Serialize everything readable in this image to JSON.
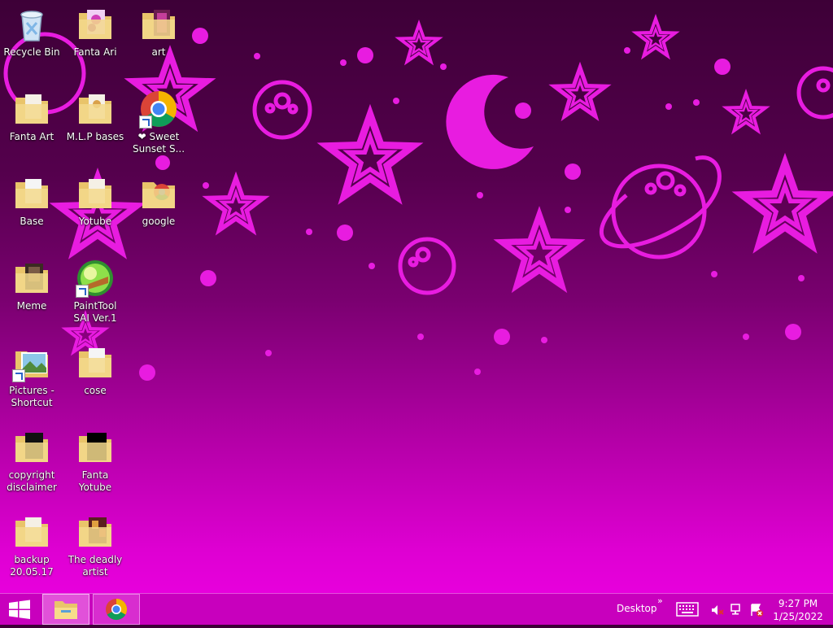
{
  "desktop": {
    "icons": [
      {
        "label": "Recycle Bin",
        "icon": "recycle-bin-icon"
      },
      {
        "label": "Fanta Ari",
        "icon": "folder-icon"
      },
      {
        "label": "art",
        "icon": "folder-icon"
      },
      {
        "label": "Fanta Art",
        "icon": "folder-icon"
      },
      {
        "label": "M.L.P bases",
        "icon": "folder-icon"
      },
      {
        "label": "❤ Sweet Sunset S...",
        "icon": "chrome-icon"
      },
      {
        "label": "Base",
        "icon": "folder-icon"
      },
      {
        "label": "Yotube",
        "icon": "folder-icon"
      },
      {
        "label": "google",
        "icon": "folder-icon"
      },
      {
        "label": "Meme",
        "icon": "folder-icon"
      },
      {
        "label": "PaintTool SAI Ver.1",
        "icon": "painttool-sai-icon"
      },
      {
        "label": "Pictures - Shortcut",
        "icon": "pictures-icon"
      },
      {
        "label": "cose",
        "icon": "folder-icon"
      },
      {
        "label": "copyright disclaimer",
        "icon": "folder-icon"
      },
      {
        "label": "Fanta Yotube",
        "icon": "folder-icon"
      },
      {
        "label": "backup 20.05.17",
        "icon": "folder-icon"
      },
      {
        "label": "The deadly artist",
        "icon": "folder-icon"
      }
    ]
  },
  "taskbar": {
    "start_icon": "windows-logo-icon",
    "pinned": [
      "file-explorer-icon",
      "chrome-icon"
    ],
    "desktop_toolbar_label": "Desktop",
    "overflow_chevron": "»",
    "tray_icons": [
      "touch-keyboard-icon",
      "volume-muted-icon",
      "network-disconnected-icon",
      "action-center-alert-icon"
    ],
    "clock": {
      "time": "9:27 PM",
      "date": "1/25/2022"
    }
  },
  "colors": {
    "accent": "#c400ba",
    "wallpaper_top": "#3d0037",
    "wallpaper_bottom": "#ee00e4",
    "wallpaper_shapes": "#e81ce0"
  }
}
